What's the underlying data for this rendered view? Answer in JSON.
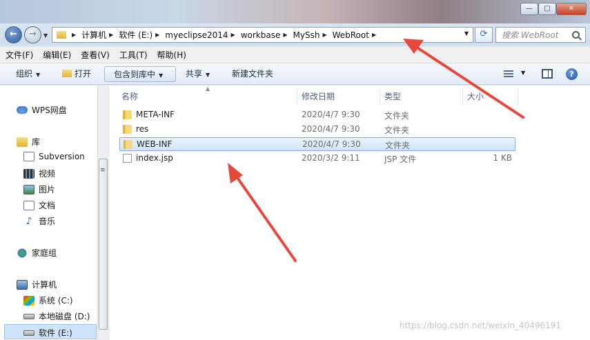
{
  "window": {
    "minimize": "—",
    "maximize": "□",
    "close": "✕"
  },
  "nav": {
    "back": "←",
    "forward": "→",
    "refresh": "⟳"
  },
  "address": {
    "crumbs": [
      "计算机",
      "软件 (E:)",
      "myeclipse2014",
      "workbase",
      "MySsh",
      "WebRoot"
    ]
  },
  "search": {
    "placeholder": "搜索 WebRoot"
  },
  "menu": [
    "文件(F)",
    "编辑(E)",
    "查看(V)",
    "工具(T)",
    "帮助(H)"
  ],
  "toolbar": {
    "organize": "组织",
    "open": "打开",
    "include_in_library": "包含到库中",
    "share": "共享",
    "new_folder": "新建文件夹"
  },
  "sidebar": {
    "favorites": [
      {
        "label": "WPS网盘",
        "icon": "cloud-icon"
      }
    ],
    "library_header": "库",
    "libraries": [
      {
        "label": "Subversion",
        "icon": "document-icon"
      },
      {
        "label": "视频",
        "icon": "video-icon"
      },
      {
        "label": "图片",
        "icon": "picture-icon"
      },
      {
        "label": "文档",
        "icon": "document-icon"
      },
      {
        "label": "音乐",
        "icon": "music-icon"
      }
    ],
    "homegroup": "家庭组",
    "computer_header": "计算机",
    "drives": [
      {
        "label": "系统 (C:)",
        "icon": "windows-drive-icon"
      },
      {
        "label": "本地磁盘 (D:)",
        "icon": "drive-icon"
      },
      {
        "label": "软件 (E:)",
        "icon": "drive-icon",
        "selected": true
      }
    ]
  },
  "columns": {
    "name": "名称",
    "date": "修改日期",
    "type": "类型",
    "size": "大小"
  },
  "files": [
    {
      "name": "META-INF",
      "date": "2020/4/7 9:30",
      "type": "文件夹",
      "size": "",
      "kind": "folder"
    },
    {
      "name": "res",
      "date": "2020/4/7 9:30",
      "type": "文件夹",
      "size": "",
      "kind": "folder"
    },
    {
      "name": "WEB-INF",
      "date": "2020/4/7 9:30",
      "type": "文件夹",
      "size": "",
      "kind": "folder",
      "selected": true
    },
    {
      "name": "index.jsp",
      "date": "2020/3/2 9:11",
      "type": "JSP 文件",
      "size": "1 KB",
      "kind": "file"
    }
  ],
  "watermark": "https://blog.csdn.net/weixin_40496191",
  "colors": {
    "arrow": "#e8473b",
    "selection": "#cfe5fa",
    "accent": "#2f6dbd"
  }
}
